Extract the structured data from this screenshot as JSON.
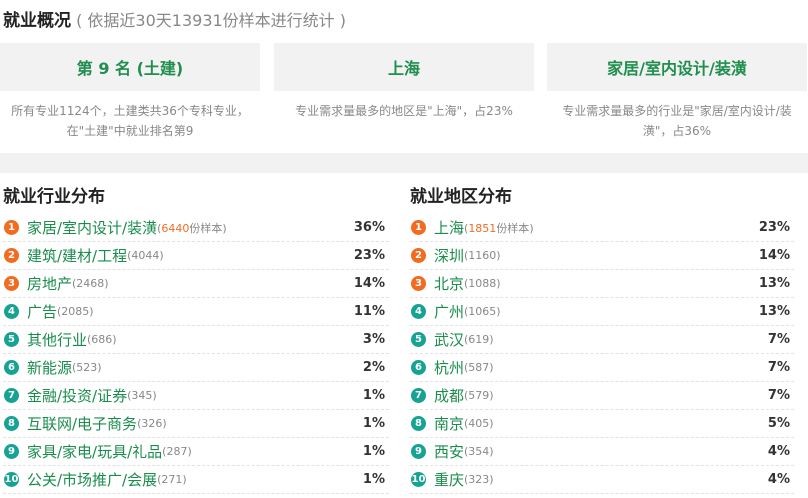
{
  "header": {
    "title": "就业概况",
    "subtitle": "( 依据近30天13931份样本进行统计 )"
  },
  "summary": [
    {
      "headline": "第 9 名 (土建)",
      "desc": "所有专业1124个，土建类共36个专科专业，在\"土建\"中就业排名第9"
    },
    {
      "headline": "上海",
      "desc": "专业需求量最多的地区是\"上海\"，占23%"
    },
    {
      "headline": "家居/室内设计/装潢",
      "desc": "专业需求量最多的行业是\"家居/室内设计/装潢\"，占36%"
    }
  ],
  "industry": {
    "title": "就业行业分布",
    "items": [
      {
        "rank": "1",
        "name": "家居/室内设计/装潢",
        "count": "6440",
        "suffix": "份样本",
        "pct": "36%"
      },
      {
        "rank": "2",
        "name": "建筑/建材/工程",
        "count": "(4044)",
        "pct": "23%"
      },
      {
        "rank": "3",
        "name": "房地产",
        "count": "(2468)",
        "pct": "14%"
      },
      {
        "rank": "4",
        "name": "广告",
        "count": "(2085)",
        "pct": "11%"
      },
      {
        "rank": "5",
        "name": "其他行业",
        "count": "(686)",
        "pct": "3%"
      },
      {
        "rank": "6",
        "name": "新能源",
        "count": "(523)",
        "pct": "2%"
      },
      {
        "rank": "7",
        "name": "金融/投资/证券",
        "count": "(345)",
        "pct": "1%"
      },
      {
        "rank": "8",
        "name": "互联网/电子商务",
        "count": "(326)",
        "pct": "1%"
      },
      {
        "rank": "9",
        "name": "家具/家电/玩具/礼品",
        "count": "(287)",
        "pct": "1%"
      },
      {
        "rank": "10",
        "name": "公关/市场推广/会展",
        "count": "(271)",
        "pct": "1%"
      }
    ]
  },
  "region": {
    "title": "就业地区分布",
    "items": [
      {
        "rank": "1",
        "name": "上海",
        "count": "1851",
        "suffix": "份样本",
        "pct": "23%"
      },
      {
        "rank": "2",
        "name": "深圳",
        "count": "(1160)",
        "pct": "14%"
      },
      {
        "rank": "3",
        "name": "北京",
        "count": "(1088)",
        "pct": "13%"
      },
      {
        "rank": "4",
        "name": "广州",
        "count": "(1065)",
        "pct": "13%"
      },
      {
        "rank": "5",
        "name": "武汉",
        "count": "(619)",
        "pct": "7%"
      },
      {
        "rank": "6",
        "name": "杭州",
        "count": "(587)",
        "pct": "7%"
      },
      {
        "rank": "7",
        "name": "成都",
        "count": "(579)",
        "pct": "7%"
      },
      {
        "rank": "8",
        "name": "南京",
        "count": "(405)",
        "pct": "5%"
      },
      {
        "rank": "9",
        "name": "西安",
        "count": "(354)",
        "pct": "4%"
      },
      {
        "rank": "10",
        "name": "重庆",
        "count": "(323)",
        "pct": "4%"
      }
    ]
  },
  "colors": {
    "accent_green": "#1f8e4e",
    "rank_top": "#f26b21",
    "rank_other": "#16a394"
  }
}
